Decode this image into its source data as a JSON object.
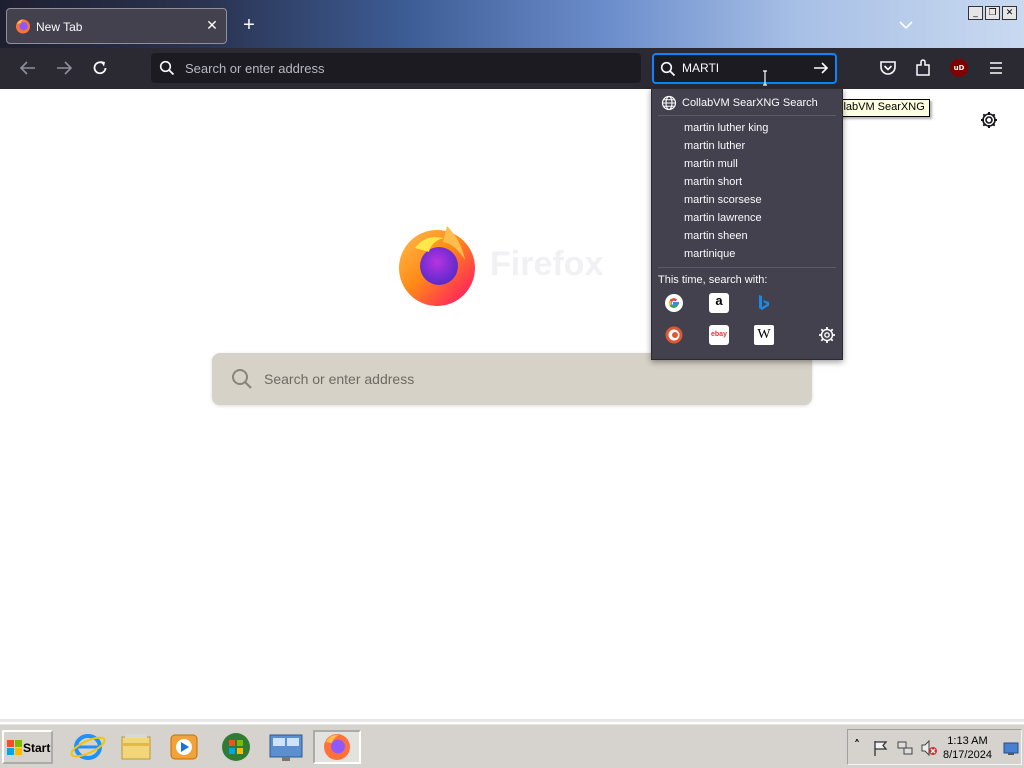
{
  "browser": {
    "tab": {
      "title": "New Tab",
      "close_glyph": "✕"
    },
    "new_tab_glyph": "+",
    "window_controls": {
      "minimize": "_",
      "restore": "❐",
      "close": "✕"
    },
    "urlbar": {
      "placeholder": "Search or enter address",
      "value": ""
    },
    "searchbar": {
      "value": "MARTI"
    },
    "toolbar_icons": [
      "pocket-icon",
      "extensions-icon",
      "ublock-origin-icon",
      "menu-icon"
    ],
    "ublock_label": "uD"
  },
  "search_popup": {
    "engine_label": "CollabVM SearXNG Search",
    "tooltip": "llabVM SearXNG",
    "suggestions": [
      "martin luther king",
      "martin luther",
      "martin mull",
      "martin short",
      "martin scorsese",
      "martin lawrence",
      "martin sheen",
      "martinique"
    ],
    "this_time_label": "This time, search with:",
    "engines": [
      "google-icon",
      "amazon-icon",
      "bing-icon",
      "duckduckgo-icon",
      "ebay-icon",
      "wikipedia-icon",
      "search-settings-icon"
    ],
    "amazon_glyph": "a",
    "ebay_glyph": "ebay",
    "wikipedia_glyph": "W"
  },
  "newtab": {
    "wordmark": "Firefox",
    "search_placeholder": "Search or enter address"
  },
  "taskbar": {
    "start_label": "Start",
    "clock_time": "1:13 AM",
    "clock_date": "8/17/2024",
    "tray_expand_glyph": "˄"
  },
  "colors": {
    "accent": "#0a84ff",
    "toolbar": "#2b2a33",
    "popup": "#42414d",
    "taskbar": "#d6d3ce"
  }
}
